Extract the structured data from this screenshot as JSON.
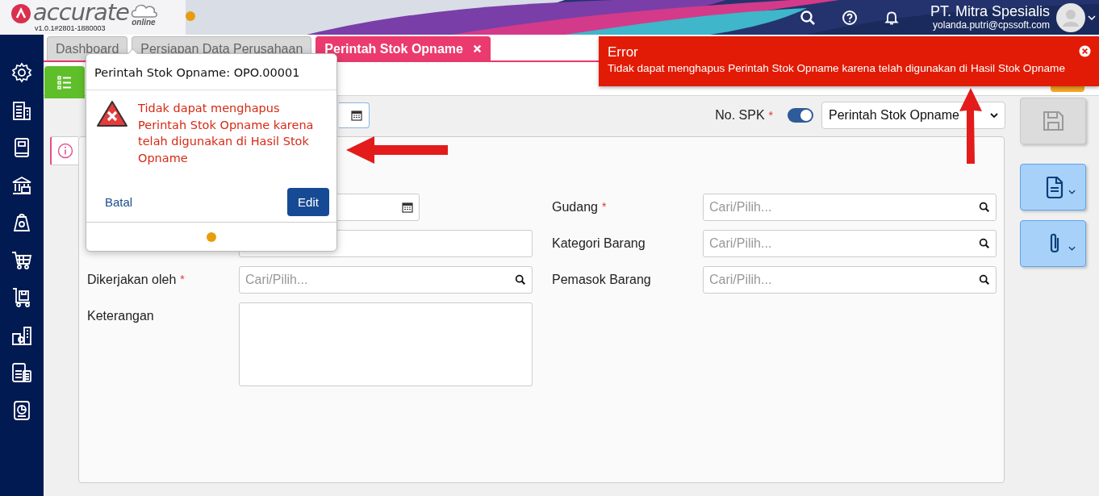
{
  "header": {
    "logo": "accurate",
    "logo_sub": "online",
    "version": "v1.0.1#2801-1880003",
    "company": "PT. Mitra Spesialis",
    "email": "yolanda.putri@cpssoft.com"
  },
  "tabs": [
    {
      "label": "Dashboard",
      "selected": false,
      "closable": false
    },
    {
      "label": "Persiapan Data Perusahaan",
      "selected": false,
      "closable": false
    },
    {
      "label": "Perintah Stok Opname",
      "selected": true,
      "closable": true
    }
  ],
  "toolbar": {
    "spk_label": "No. SPK",
    "spk_required_mark": "*",
    "spk_toggle_on": true,
    "spk_value": "Perintah Stok Opname"
  },
  "form": {
    "left": [
      {
        "kind": "date"
      },
      {
        "kind": "text"
      },
      {
        "kind": "search",
        "label": "Dikerjakan oleh",
        "required_mark": "*",
        "placeholder": "Cari/Pilih..."
      },
      {
        "kind": "textarea",
        "label": "Keterangan"
      }
    ],
    "right": [
      {
        "kind": "search",
        "label": "Gudang",
        "required_mark": "*",
        "placeholder": "Cari/Pilih..."
      },
      {
        "kind": "search",
        "label": "Kategori Barang",
        "placeholder": "Cari/Pilih..."
      },
      {
        "kind": "search",
        "label": "Pemasok Barang",
        "placeholder": "Cari/Pilih..."
      }
    ]
  },
  "popover": {
    "title": "Perintah Stok Opname: OPO.00001",
    "message": "Tidak dapat menghapus Perintah Stok Opname karena telah digunakan di Hasil Stok Opname",
    "cancel": "Batal",
    "confirm": "Edit"
  },
  "error_toast": {
    "title": "Error",
    "message": "Tidak dapat menghapus Perintah Stok Opname karena telah digunakan di Hasil Stok Opname"
  }
}
